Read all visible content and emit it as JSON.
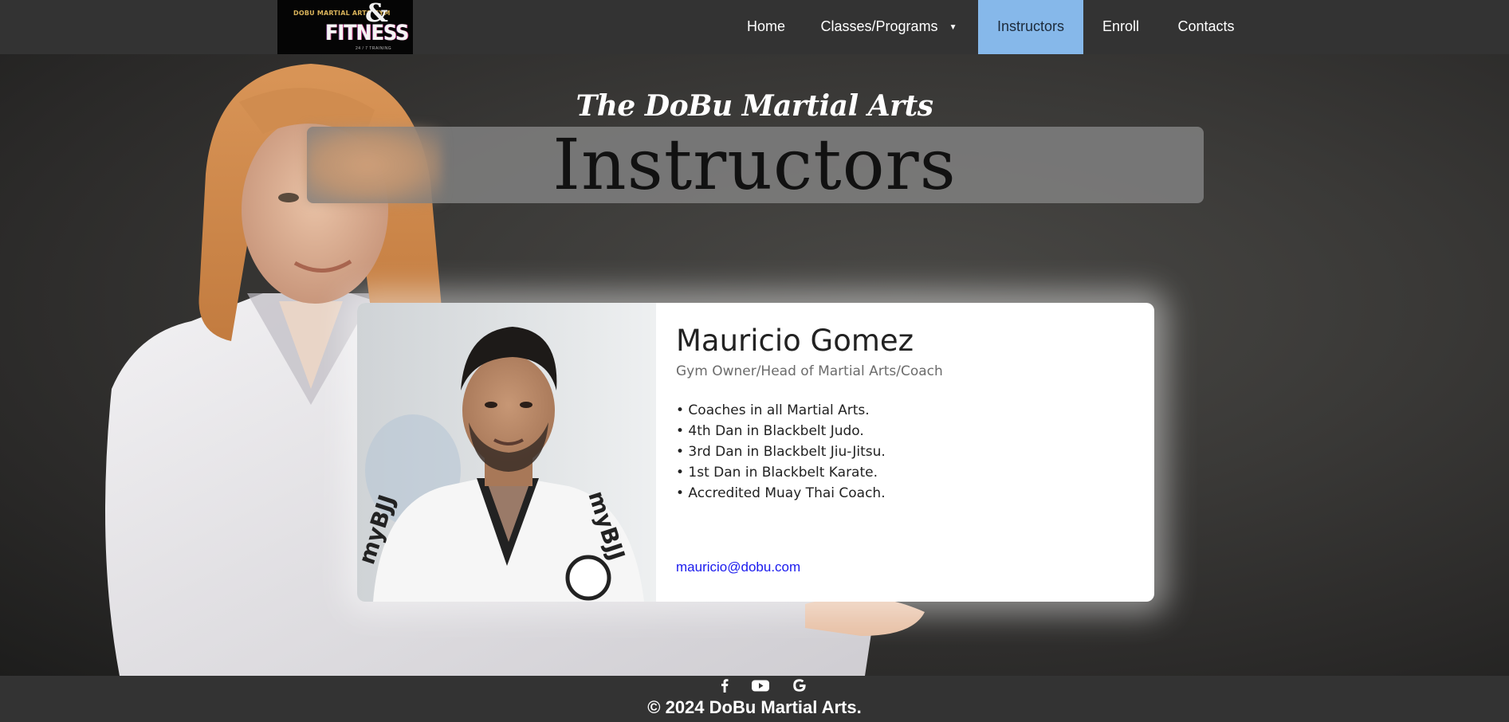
{
  "nav": {
    "logo_text_1": "DOBU MARTIAL ARTS GYM",
    "logo_text_2": "FITNESS",
    "logo_amp": "&",
    "logo_text_3": "24 / 7 TRAINING",
    "items": [
      {
        "label": "Home"
      },
      {
        "label": "Classes/Programs",
        "caret": "▼"
      },
      {
        "label": "Instructors",
        "active": true
      },
      {
        "label": "Enroll"
      },
      {
        "label": "Contacts"
      }
    ],
    "active_color": "#86b8ea",
    "bar_color": "#333333"
  },
  "hero": {
    "subtitle": "The DoBu Martial Arts",
    "title": "Instructors"
  },
  "card": {
    "name": "Mauricio Gomez",
    "role": "Gym Owner/Head of Martial Arts/Coach",
    "achievements": [
      "• Coaches in all Martial Arts.",
      "• 4th Dan in Blackbelt Judo.",
      "• 3rd Dan in Blackbelt Jiu-Jitsu.",
      "• 1st Dan in Blackbelt Karate.",
      "• Accredited Muay Thai Coach."
    ],
    "email": "mauricio@dobu.com",
    "link_color": "#1a1aee"
  },
  "footer": {
    "icons": [
      "facebook-icon",
      "youtube-icon",
      "google-icon"
    ],
    "copyright": "© 2024 DoBu Martial Arts."
  }
}
